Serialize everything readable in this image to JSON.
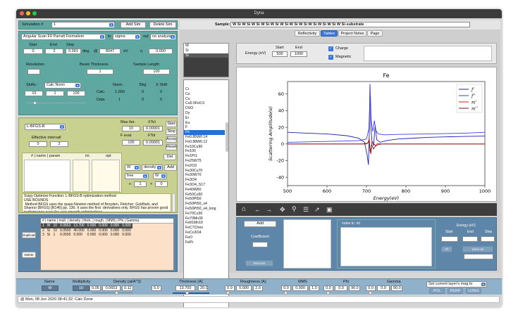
{
  "window": {
    "title": "Dyna"
  },
  "sim": {
    "label": "Simulation #",
    "value": "1",
    "add_btn": "Add Sim",
    "delete_btn": "Delete Sim"
  },
  "sample": {
    "label": "Sample:",
    "value": "W Si W Si W Si W Si W Si W Si W Si W Si W Si W Si W Si W Si-substrate"
  },
  "scan": {
    "formalism": "Angular Scan F0 Parratt Formalism",
    "in_label": "in",
    "in_value": "sigma",
    "out_label": "out",
    "out_value": "no analyzer",
    "start_label": "Start",
    "end_label": "End",
    "step_label": "Step",
    "start": "0",
    "end": "2",
    "step": "0.001",
    "deg": "deg.",
    "at": "@",
    "energy": "8047",
    "ev": "eV",
    "eta_symbol": "η",
    "eta": "0.000",
    "resolution_label": "Resolution",
    "thickness_label": "Beam Thickness",
    "length_label": "Sample Length",
    "resolution": "",
    "thickness": "1",
    "length": "100",
    "shifts_label": "Shifts :",
    "shifts_mode": "Calc Norm",
    "norm_label": "Norm.",
    "bkg_label": "Bkg",
    "xshift_label": "X Shift",
    "shift1": ".01",
    "shift2": "1",
    "shift3": "100",
    "calc_label": "Calc.",
    "calc_norm": "1.000",
    "calc_bkg": "0",
    "calc_x": "0",
    "data_label": "Data",
    "data_norm": "1",
    "data_bkg": "0",
    "data_x": "0"
  },
  "optimizer": {
    "method": "L-BFGS-B",
    "max_iter_label": "Max Iter.",
    "max_iter": "10",
    "xtol_label": "XTol",
    "xtol": "0.00001",
    "fevel_label": "F eval.",
    "fevel": "100",
    "ftol_label": "FTol",
    "ftol": "0.00001",
    "eff_interval_label": "Effective intervall",
    "eff_lo": "0",
    "eff_hi": "2",
    "start_btn": "Start",
    "stop_btn": "Stop",
    "accept_btn": "Accept",
    "reset_btn": "Reset",
    "del_btn": "Del",
    "add_btn": "Add",
    "col_param": "# | name | param",
    "col_ini": "ini.",
    "col_opt": "opt",
    "layer_sel": "W",
    "prop_sel": "density",
    "mode_sel": "free",
    "mode_layer_sel": "W",
    "x_label": "x",
    "x_val": "1",
    "plus_label": "+",
    "plus_val": "0",
    "log": "Scipy Optimize Function: L-BFGS-B optimization method\nUSE BOUNDS\n Method BFGS uses the quasi-Newton method of Broyden, Fletcher  Goldfarb, and Shanno (BFGS) [R146] pp. 136. It uses the first  derivatives only. BFGS has proven good performance even for  non-smooth optimizations."
  },
  "layers": {
    "header": "# | name | mult. | density | thick. | rough. | MMS | Phi | Gamma",
    "rows": [
      [
        "1",
        "W",
        "10",
        "0.0653",
        "13.700",
        "0.000",
        "0.000",
        "0.000",
        "0.000"
      ],
      [
        "2",
        "Si",
        "10",
        "0.0500",
        "40.000",
        "0.000",
        "0.000",
        "0.000",
        "0.000"
      ],
      [
        "3",
        "Si",
        "1",
        "0.0500",
        "0.000",
        "0.000",
        "0.000",
        "0.000",
        "0.000"
      ]
    ],
    "duplicate_btn": "Duplicate",
    "delete_btn": "Delete"
  },
  "elements_top": [
    "W",
    "Si",
    "Si"
  ],
  "elements": [
    "Cr",
    "Cs",
    "Cu",
    "Cu0.5Fe0.5",
    "DSO",
    "Dy",
    "Er",
    "Eu",
    "F",
    "Fe",
    "Fe0.85W0.14",
    "Fe0.88W0.12",
    "Fe10Cu90",
    "Fe100",
    "Fe1Pt1",
    "Fe25W75",
    "Fe2O3",
    "Fe30Cu70",
    "Fe30W70",
    "Fe3O4",
    "Fe3O4_S17",
    "Fe40W60",
    "Fe50Cu50",
    "Fe50Pt50",
    "Fe50Pt50_s4",
    "Fe50Pt50_s4_long",
    "Fe70Cu30",
    "Fe70Mn30",
    "Fe81Mn19",
    "FeC7Chen",
    "FeCo3O4",
    "FeO",
    "FePt"
  ],
  "selected_element": "Fe",
  "tabs": [
    "Reflectivity",
    "Tables",
    "Project Notes",
    "Page"
  ],
  "active_tab": "Tables",
  "energy": {
    "label": "Energy (eV)",
    "start_label": "Start",
    "end_label": "End",
    "start": "500",
    "end": "1000",
    "charge": "Charge",
    "magnetic": "Magnetic"
  },
  "chart_data": {
    "type": "line",
    "title": "Fe",
    "xlabel": "Energy(eV)",
    "ylabel": "Scattering Amplitude(e)",
    "xlim": [
      500,
      1000
    ],
    "ylim": [
      -50,
      75
    ],
    "xticks": [
      500,
      600,
      700,
      800,
      900,
      1000
    ],
    "yticks": [
      -40,
      -20,
      0,
      20,
      40,
      60
    ],
    "legend_position": "top-right",
    "series": [
      {
        "name": "f'",
        "color": "#1f1fb4",
        "x": [
          500,
          550,
          600,
          650,
          680,
          695,
          702,
          705,
          707,
          709,
          711,
          714,
          718,
          722,
          726,
          735,
          750,
          780,
          820,
          860,
          900,
          950,
          1000
        ],
        "y": [
          14,
          13,
          12,
          10,
          7,
          2,
          -14,
          -25,
          8,
          72,
          20,
          4,
          -2,
          22,
          5,
          2,
          4,
          6,
          7,
          8,
          8.5,
          9,
          9.5
        ]
      },
      {
        "name": "f''",
        "color": "#3c3cf0",
        "x": [
          500,
          600,
          680,
          700,
          706,
          708,
          710,
          712,
          716,
          720,
          724,
          730,
          745,
          780,
          850,
          950,
          1000
        ],
        "y": [
          2,
          3,
          4,
          6,
          18,
          45,
          57,
          28,
          15,
          28,
          16,
          12,
          11,
          11.5,
          12,
          13,
          14
        ]
      },
      {
        "name": "m'",
        "color": "#e01b1b",
        "x": [
          500,
          680,
          700,
          705,
          707,
          709,
          711,
          714,
          718,
          722,
          728,
          740,
          1000
        ],
        "y": [
          0,
          0,
          0,
          2,
          7,
          -8,
          -12,
          3,
          1,
          -2,
          0.5,
          0,
          0
        ]
      },
      {
        "name": "m''",
        "color": "#7a1010",
        "x": [
          500,
          690,
          703,
          706,
          708,
          710,
          713,
          718,
          722,
          730,
          740,
          1000
        ],
        "y": [
          0,
          0,
          1,
          4,
          -2,
          -10,
          -1,
          -6,
          -3,
          -0.5,
          0,
          0
        ]
      }
    ]
  },
  "plot_toolbar_icons": [
    "home-icon",
    "back-icon",
    "forward-icon",
    "pan-icon",
    "zoom-icon",
    "configure-icon",
    "edit-curves-icon",
    "save-icon"
  ],
  "atoms": {
    "add_btn": "Add",
    "coefficient_label": "Coefficient",
    "remove_btn": "Remove",
    "notes_label": "notes to .txt"
  },
  "energy_right": {
    "label": "Energy (eV)",
    "start": "Start",
    "end": "End",
    "step": "Step",
    "fit_btn": "Fit",
    "save_btn": "Save as"
  },
  "bottom": {
    "name_label": "Name",
    "name": "W",
    "mult_label": "Multiplicity",
    "mult": "10",
    "density_label": "Density (at/A^3)",
    "density_min": "0.05",
    "density": "0.0653",
    "density_max": "0.12",
    "thick_label": "Thickness (A)",
    "thick_min": "5.0",
    "thick": "13.700",
    "thick_max": "20.0",
    "rough_label": "Roughness (A)",
    "rough_min": "0.0",
    "rough": "0.000",
    "rough_max": "2.0",
    "mms_label": "MMS",
    "mms_min": "0.0",
    "mms": "0.000",
    "mms_max": "1.0",
    "phi_label": "Phi",
    "phi_min": "0.0",
    "phi": "0.0",
    "phi_max": "90.0",
    "gamma_label": "Gamma",
    "gamma_min": "0.0",
    "gamma": "0.0",
    "gamma_max": "90.0",
    "mag_select": "Set current layer's mag to",
    "pol_btn": "POL",
    "perp_btn": "PERP",
    "long_btn": "LONG"
  },
  "status": {
    "text": "@ Mon, 08 Jun 2020 08:41:32: Calc Done"
  }
}
